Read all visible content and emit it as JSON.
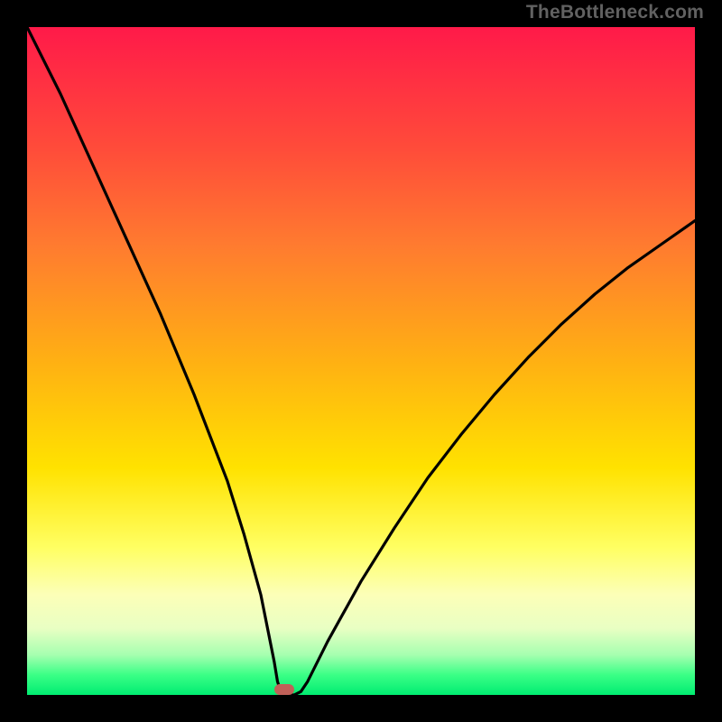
{
  "attribution": "TheBottleneck.com",
  "chart_data": {
    "type": "line",
    "title": "",
    "xlabel": "",
    "ylabel": "",
    "xlim": [
      0,
      100
    ],
    "ylim": [
      0,
      100
    ],
    "x": [
      0,
      5,
      10,
      15,
      20,
      25,
      30,
      32.5,
      35,
      36,
      37,
      37.5,
      38,
      38.5,
      39,
      40,
      41,
      42,
      45,
      50,
      55,
      60,
      65,
      70,
      75,
      80,
      85,
      90,
      95,
      100
    ],
    "values": [
      100,
      90,
      79,
      68,
      57,
      45,
      32,
      24,
      15,
      10,
      5,
      2,
      0.5,
      0,
      0,
      0,
      0.5,
      2,
      8,
      17,
      25,
      32.5,
      39,
      45,
      50.5,
      55.5,
      60,
      64,
      67.5,
      71
    ],
    "marker": {
      "x": 38.5,
      "y": 0.8,
      "color": "#c06058"
    },
    "background_gradient_top_color": "#ff1a49",
    "background_gradient_bottom_color": "#00ec71"
  }
}
